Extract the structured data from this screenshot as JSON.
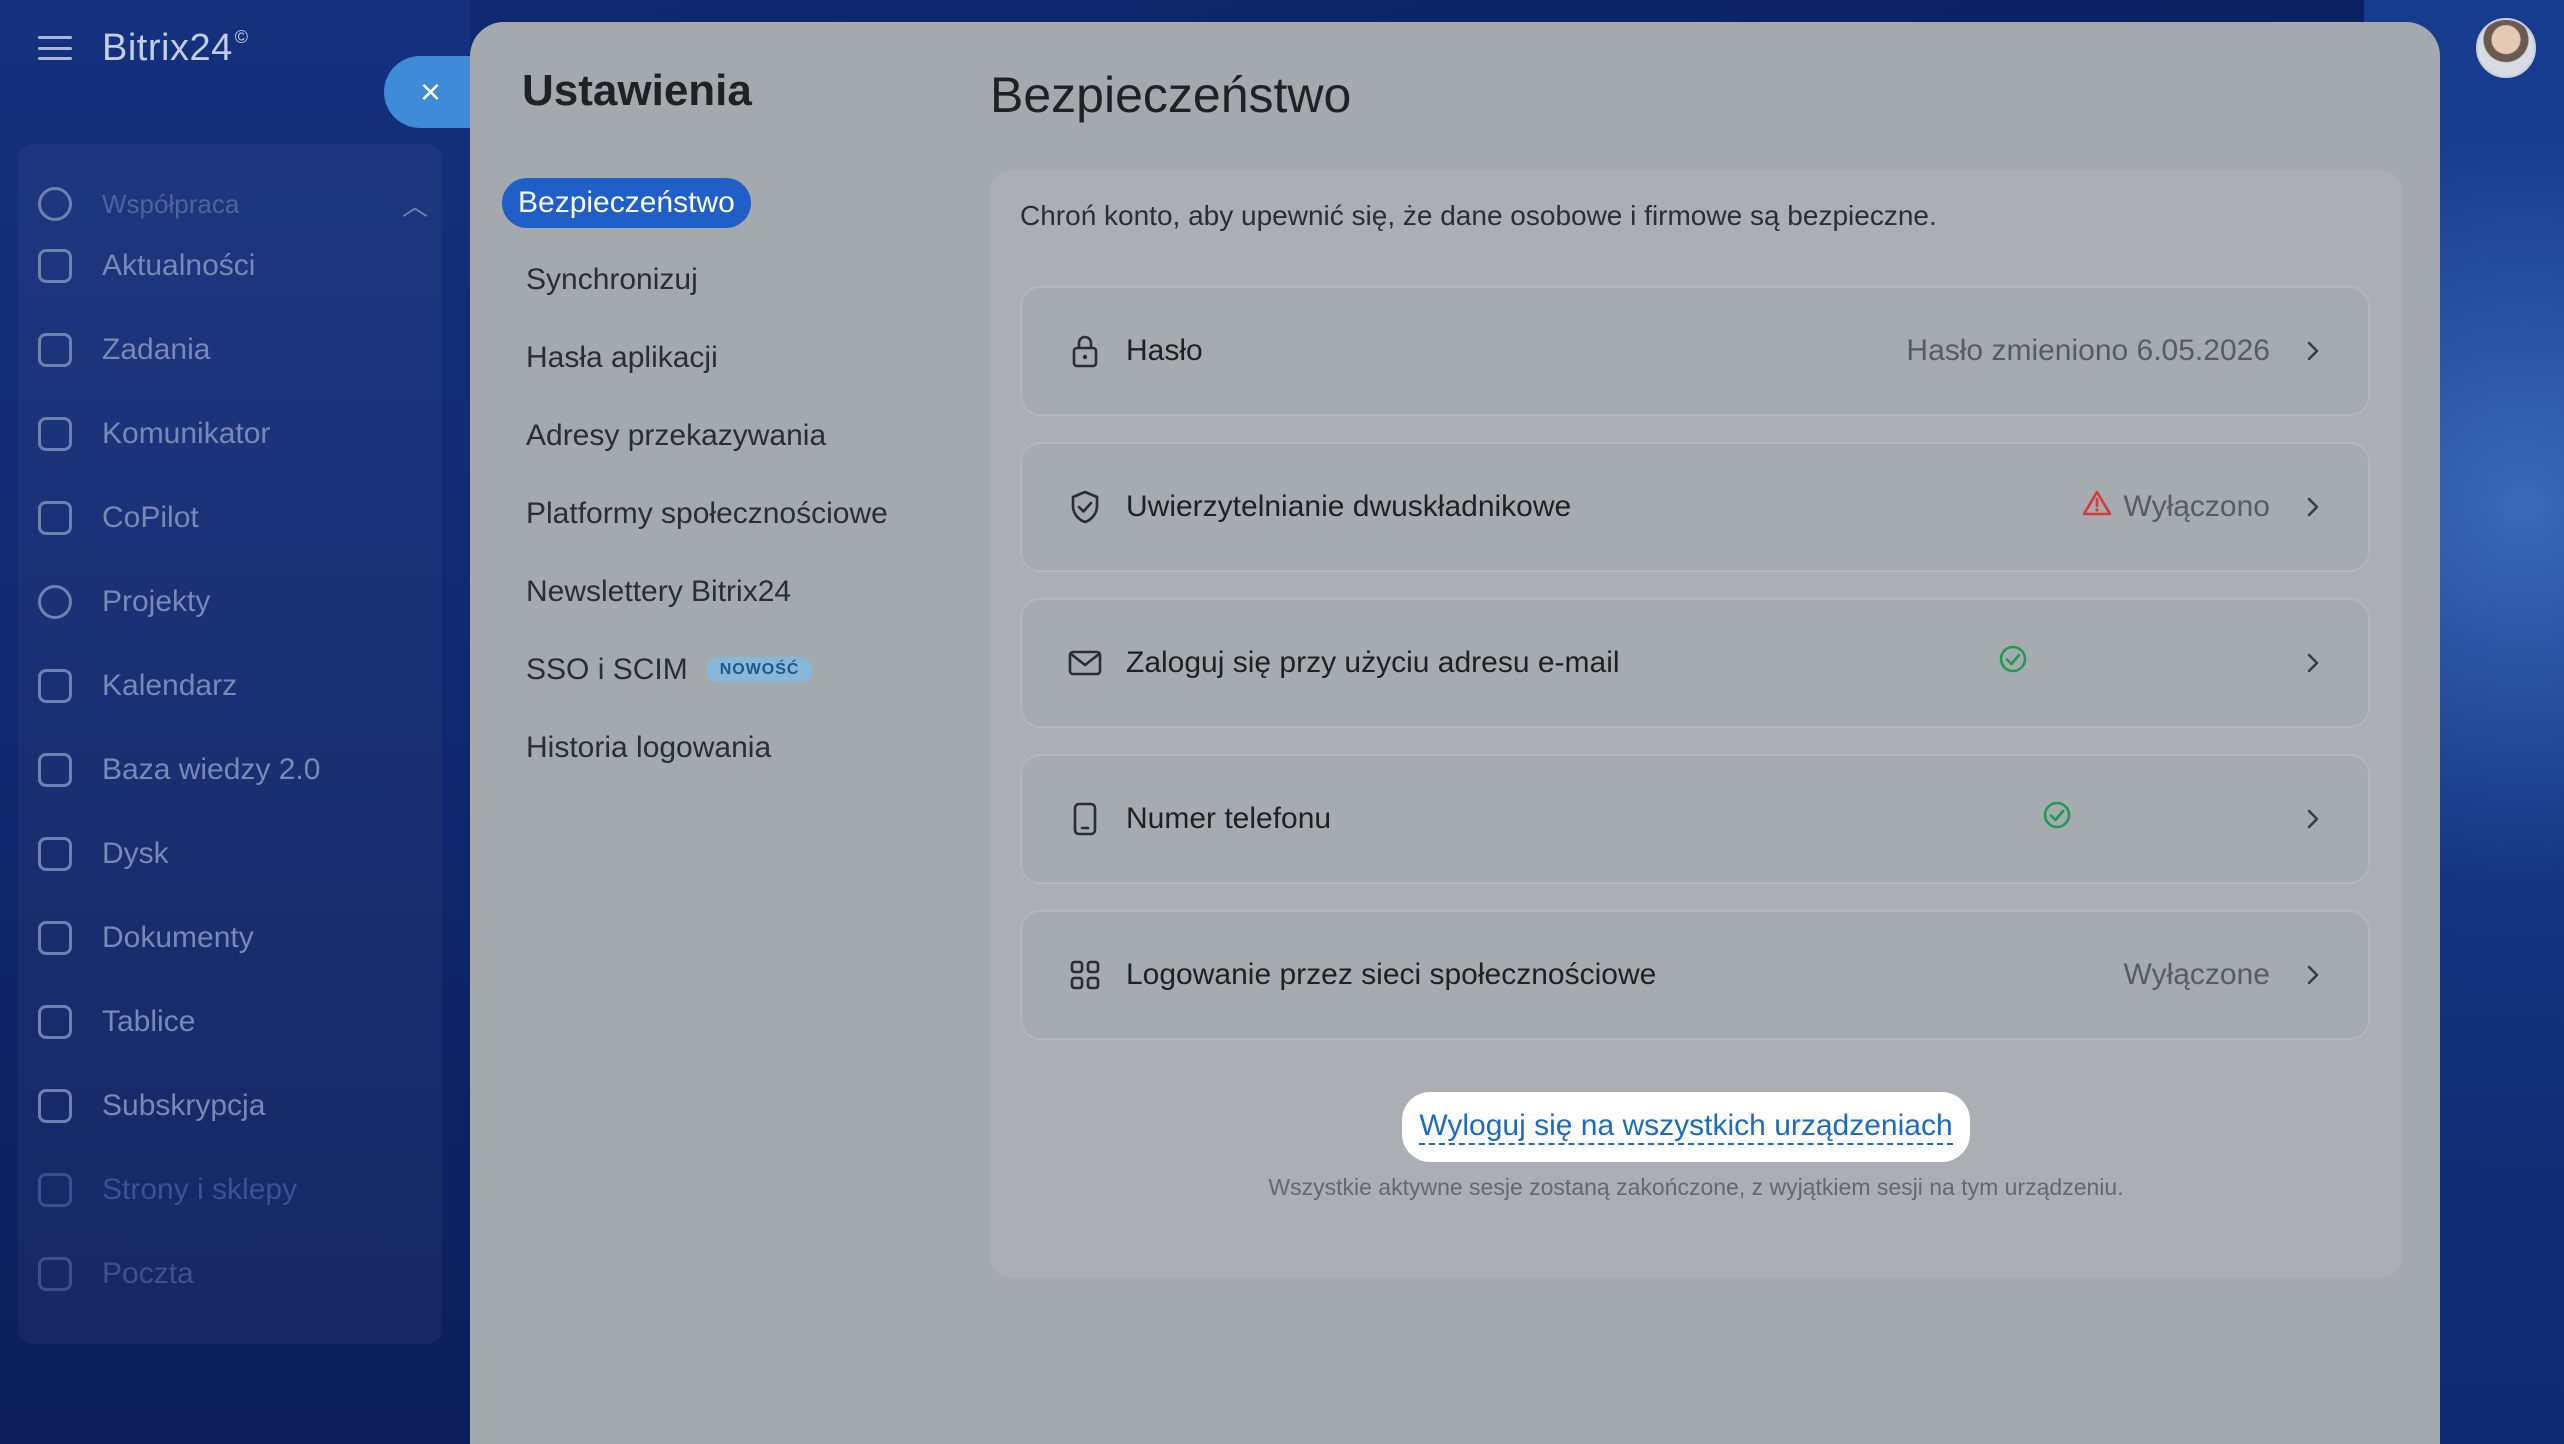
{
  "app": {
    "logo": "Bitrix24",
    "logo_mark": "©"
  },
  "sidebar": {
    "group_title": "Współpraca",
    "items": [
      {
        "label": "Aktualności"
      },
      {
        "label": "Zadania"
      },
      {
        "label": "Komunikator"
      },
      {
        "label": "CoPilot"
      },
      {
        "label": "Projekty"
      },
      {
        "label": "Kalendarz"
      },
      {
        "label": "Baza wiedzy 2.0"
      },
      {
        "label": "Dysk"
      },
      {
        "label": "Dokumenty"
      },
      {
        "label": "Tablice"
      },
      {
        "label": "Subskrypcja"
      },
      {
        "label": "Strony i sklepy"
      },
      {
        "label": "Poczta"
      }
    ]
  },
  "close_icon": "×",
  "settings": {
    "title": "Ustawienia",
    "menu": [
      {
        "label": "Bezpieczeństwo"
      },
      {
        "label": "Synchronizuj"
      },
      {
        "label": "Hasła aplikacji"
      },
      {
        "label": "Adresy przekazywania"
      },
      {
        "label": "Platformy społecznościowe"
      },
      {
        "label": "Newslettery Bitrix24"
      },
      {
        "label": "SSO i SCIM",
        "badge": "NOWOŚĆ"
      },
      {
        "label": "Historia logowania"
      }
    ]
  },
  "security": {
    "title": "Bezpieczeństwo",
    "intro": "Chroń konto, aby upewnić się, że dane osobowe i firmowe są bezpieczne.",
    "rows": [
      {
        "label": "Hasło",
        "status": "Hasło zmieniono 6.05.2026",
        "icon": "lock-icon"
      },
      {
        "label": "Uwierzytelnianie dwuskładnikowe",
        "status": "Wyłączono",
        "icon": "shield-icon",
        "status_icon": "warning-icon"
      },
      {
        "label": "Zaloguj się przy użyciu adresu e-mail",
        "status": "",
        "icon": "mail-icon",
        "status_icon": "check-icon"
      },
      {
        "label": "Numer telefonu",
        "status": "",
        "icon": "phone-icon",
        "status_icon": "check-icon"
      },
      {
        "label": "Logowanie przez sieci społecznościowe",
        "status": "Wyłączone",
        "icon": "grid-icon"
      }
    ],
    "logout_label": "Wyloguj się na wszystkich urządzeniach",
    "logout_note": "Wszystkie aktywne sesje zostaną zakończone, z wyjątkiem sesji na tym urządzeniu."
  },
  "colors": {
    "accent": "#1f5fc7",
    "link": "#1a6bc1",
    "success": "#1e9a55",
    "warning": "#d63b3b"
  }
}
